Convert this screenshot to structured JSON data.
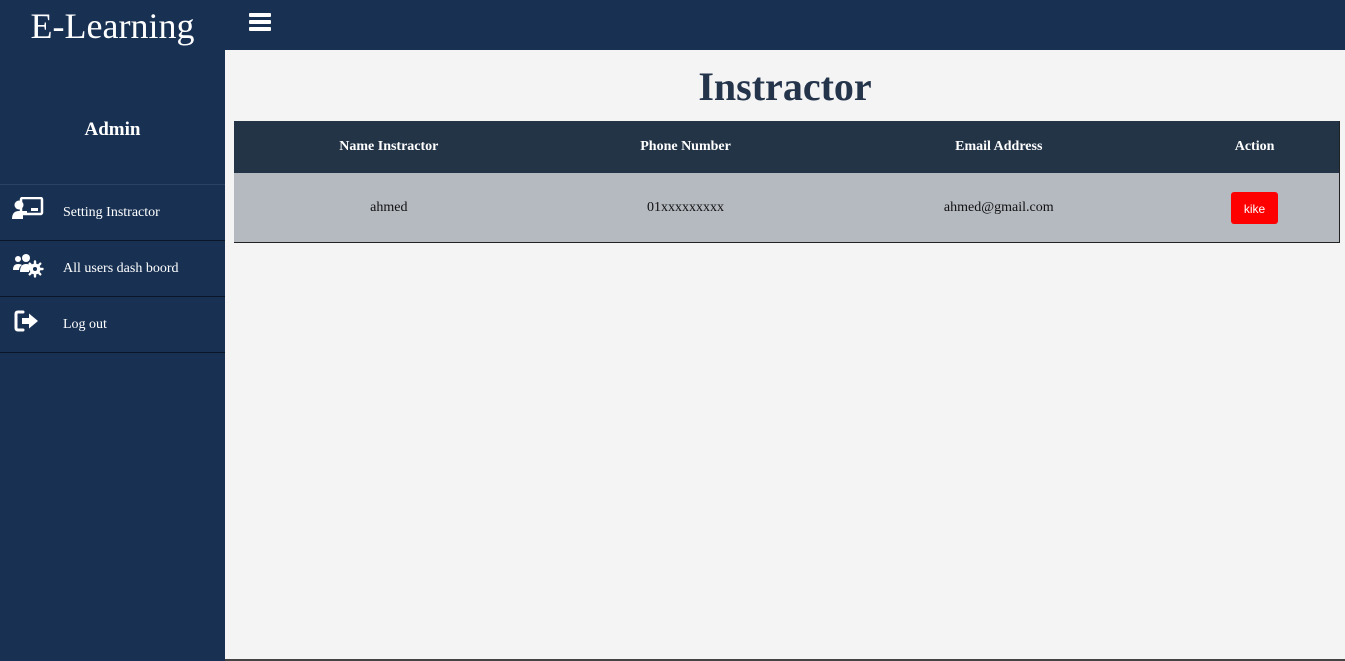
{
  "header": {
    "brand": "E-Learning",
    "menu_icon": "hamburger-menu-icon"
  },
  "sidebar": {
    "user_label": "Admin",
    "items": [
      {
        "label": "Setting Instractor",
        "icon": "chalkboard-teacher-icon"
      },
      {
        "label": "All users dash boord",
        "icon": "users-cog-icon"
      },
      {
        "label": "Log out",
        "icon": "sign-out-icon"
      }
    ]
  },
  "main": {
    "title": "Instractor",
    "table": {
      "headers": [
        "Name Instractor",
        "Phone Number",
        "Email Address",
        "Action"
      ],
      "rows": [
        {
          "name": "ahmed",
          "phone": "01xxxxxxxxx",
          "email": "ahmed@gmail.com",
          "action_label": "kike"
        }
      ]
    }
  },
  "colors": {
    "navy": "#183153",
    "table_header": "#233447",
    "row_bg": "#b5b9c0",
    "danger": "#ff0000",
    "content_bg": "#f4f4f4"
  }
}
